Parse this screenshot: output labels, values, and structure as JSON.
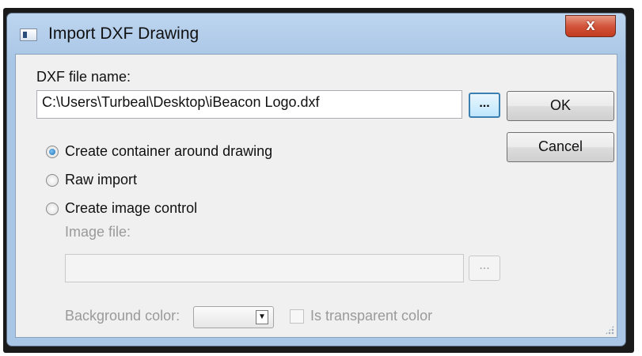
{
  "window": {
    "title": "Import DXF Drawing",
    "close_label": "x"
  },
  "file": {
    "label": "DXF file name:",
    "value": "C:\\Users\\Turbeal\\Desktop\\iBeacon Logo.dxf",
    "browse_label": "..."
  },
  "buttons": {
    "ok_label": "OK",
    "cancel_label": "Cancel"
  },
  "options": [
    {
      "label": "Create container around drawing",
      "checked": true
    },
    {
      "label": "Raw import",
      "checked": false
    },
    {
      "label": "Create image control",
      "checked": false
    }
  ],
  "image_control": {
    "image_file_label": "Image file:",
    "image_file_value": "",
    "browse_label": "...",
    "background_color_label": "Background color:",
    "background_color_value": "",
    "transparent_label": "Is transparent color",
    "transparent_checked": false
  },
  "colors": {
    "title_bar": "#bdd5ef",
    "client_bg": "#f0f0f0",
    "close_button": "#c23b20",
    "radio_selected": "#1b6db3"
  }
}
